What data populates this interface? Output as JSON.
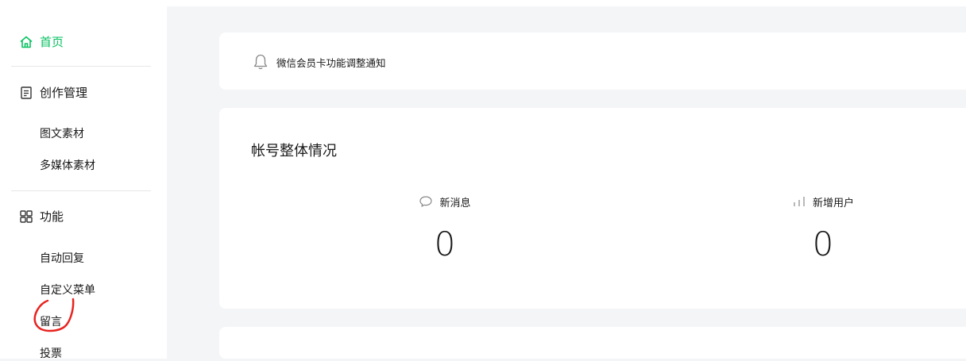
{
  "sidebar": {
    "home_label": "首页",
    "create_section_label": "创作管理",
    "create_items": [
      "图文素材",
      "多媒体素材"
    ],
    "function_section_label": "功能",
    "function_items": [
      "自动回复",
      "自定义菜单",
      "留言",
      "投票"
    ]
  },
  "notice": {
    "text": "微信会员卡功能调整通知"
  },
  "stats": {
    "title": "帐号整体情况",
    "items": [
      {
        "label": "新消息",
        "value": "0",
        "icon": "chat-bubble-icon"
      },
      {
        "label": "新增用户",
        "value": "0",
        "icon": "bar-chart-icon"
      }
    ]
  },
  "colors": {
    "accent": "#07c160",
    "background": "#f4f5f7",
    "annotation": "#e8231f"
  }
}
